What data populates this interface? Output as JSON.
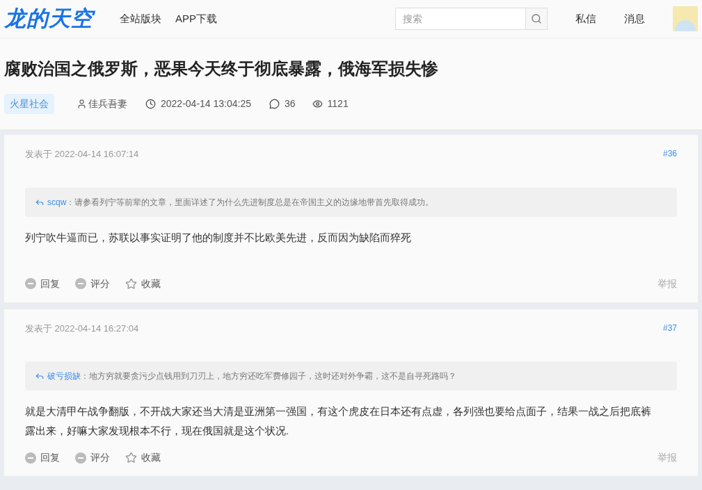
{
  "header": {
    "logo": "龙的天空",
    "nav": [
      {
        "label": "全站版块"
      },
      {
        "label": "APP下载"
      }
    ],
    "search": {
      "placeholder": "搜索"
    },
    "links": [
      {
        "label": "私信"
      },
      {
        "label": "消息"
      }
    ]
  },
  "thread": {
    "title": "腐败治国之俄罗斯，恶果今天终于彻底暴露，俄海军损失惨",
    "tag": "火星社会",
    "author": "佳兵吾妻",
    "time": "2022-04-14 13:04:25",
    "replies": "36",
    "views": "1121"
  },
  "posts": [
    {
      "posted": "发表于 2022-04-14 16:07:14",
      "floor": "#36",
      "quote_user": "scqw",
      "quote_text": "：请参看列宁等前辈的文章，里面详述了为什么先进制度总是在帝国主义的边缘地带首先取得成功。",
      "body": "列宁吹牛逼而已，苏联以事实证明了他的制度并不比欧美先进，反而因为缺陷而猝死",
      "actions": [
        "回复",
        "评分",
        "收藏"
      ],
      "report": "举报"
    },
    {
      "posted": "发表于 2022-04-14 16:27:04",
      "floor": "#37",
      "quote_user": "破亏损缺",
      "quote_text": "：地方穷就要贪污少点钱用到刀刃上，地方穷还吃军费修园子，这时还对外争霸，这不是自寻死路吗？",
      "body": "就是大清甲午战争翻版，不开战大家还当大清是亚洲第一强国，有这个虎皮在日本还有点虚，各列强也要给点面子，结果一战之后把底裤露出来，好嘛大家发现根本不行，现在俄国就是这个状况.",
      "actions": [
        "回复",
        "评分",
        "收藏"
      ],
      "report": "举报"
    }
  ]
}
